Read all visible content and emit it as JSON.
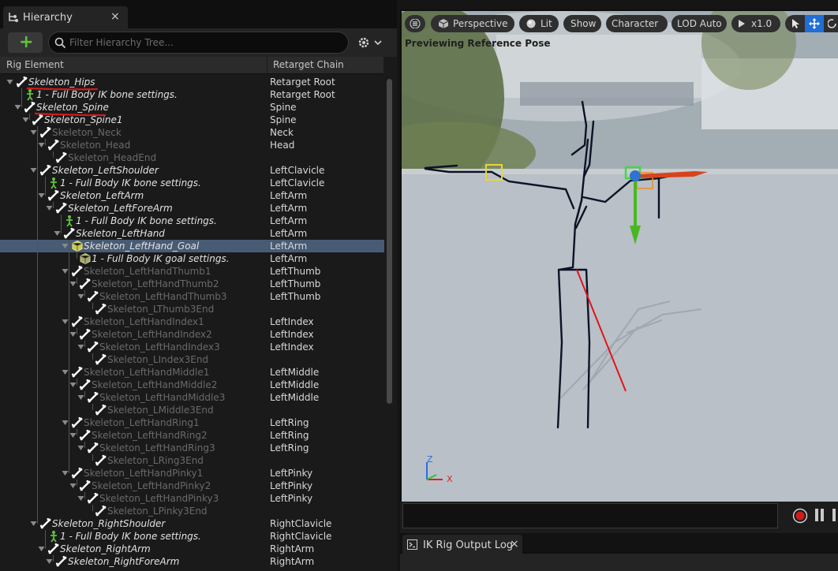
{
  "hierarchy_panel": {
    "tab_label": "Hierarchy",
    "tab_close": "×",
    "search_placeholder": "Filter Hierarchy Tree...",
    "add_label": "+",
    "columns": {
      "rig_element": "Rig Element",
      "retarget_chain": "Retarget Chain"
    },
    "rows": [
      {
        "label": "Skeleton_Hips",
        "chain": "Retarget Root",
        "depth": 0,
        "icon": "bone",
        "expanded": true
      },
      {
        "label": "1 - Full Body IK bone settings.",
        "chain": "Retarget Root",
        "depth": 1,
        "icon": "ik-setting"
      },
      {
        "label": "Skeleton_Spine",
        "chain": "Spine",
        "depth": 1,
        "icon": "bone",
        "expanded": true
      },
      {
        "label": "Skeleton_Spine1",
        "chain": "Spine",
        "depth": 2,
        "icon": "bone",
        "expanded": true
      },
      {
        "label": "Skeleton_Neck",
        "chain": "Neck",
        "depth": 3,
        "icon": "bone",
        "expanded": true,
        "dim": true
      },
      {
        "label": "Skeleton_Head",
        "chain": "Head",
        "depth": 4,
        "icon": "bone",
        "expanded": true,
        "dim": true
      },
      {
        "label": "Skeleton_HeadEnd",
        "chain": "",
        "depth": 5,
        "icon": "bone",
        "dim": true
      },
      {
        "label": "Skeleton_LeftShoulder",
        "chain": "LeftClavicle",
        "depth": 3,
        "icon": "bone",
        "expanded": true
      },
      {
        "label": "1 - Full Body IK bone settings.",
        "chain": "LeftClavicle",
        "depth": 4,
        "icon": "ik-setting"
      },
      {
        "label": "Skeleton_LeftArm",
        "chain": "LeftArm",
        "depth": 4,
        "icon": "bone",
        "expanded": true
      },
      {
        "label": "Skeleton_LeftForeArm",
        "chain": "LeftArm",
        "depth": 5,
        "icon": "bone",
        "expanded": true
      },
      {
        "label": "1 - Full Body IK bone settings.",
        "chain": "LeftArm",
        "depth": 6,
        "icon": "ik-setting"
      },
      {
        "label": "Skeleton_LeftHand",
        "chain": "LeftArm",
        "depth": 6,
        "icon": "bone",
        "expanded": true
      },
      {
        "label": "Skeleton_LeftHand_Goal",
        "chain": "LeftArm",
        "depth": 7,
        "icon": "goal",
        "expanded": true,
        "selected": true
      },
      {
        "label": "1 - Full Body IK goal settings.",
        "chain": "LeftArm",
        "depth": 8,
        "icon": "goal-setting"
      },
      {
        "label": "Skeleton_LeftHandThumb1",
        "chain": "LeftThumb",
        "depth": 7,
        "icon": "bone",
        "expanded": true,
        "dim": true
      },
      {
        "label": "Skeleton_LeftHandThumb2",
        "chain": "LeftThumb",
        "depth": 8,
        "icon": "bone",
        "expanded": true,
        "dim": true
      },
      {
        "label": "Skeleton_LeftHandThumb3",
        "chain": "LeftThumb",
        "depth": 9,
        "icon": "bone",
        "expanded": true,
        "dim": true
      },
      {
        "label": "Skeleton_LThumb3End",
        "chain": "",
        "depth": 10,
        "icon": "bone",
        "dim": true
      },
      {
        "label": "Skeleton_LeftHandIndex1",
        "chain": "LeftIndex",
        "depth": 7,
        "icon": "bone",
        "expanded": true,
        "dim": true
      },
      {
        "label": "Skeleton_LeftHandIndex2",
        "chain": "LeftIndex",
        "depth": 8,
        "icon": "bone",
        "expanded": true,
        "dim": true
      },
      {
        "label": "Skeleton_LeftHandIndex3",
        "chain": "LeftIndex",
        "depth": 9,
        "icon": "bone",
        "expanded": true,
        "dim": true
      },
      {
        "label": "Skeleton_LIndex3End",
        "chain": "",
        "depth": 10,
        "icon": "bone",
        "dim": true
      },
      {
        "label": "Skeleton_LeftHandMiddle1",
        "chain": "LeftMiddle",
        "depth": 7,
        "icon": "bone",
        "expanded": true,
        "dim": true
      },
      {
        "label": "Skeleton_LeftHandMiddle2",
        "chain": "LeftMiddle",
        "depth": 8,
        "icon": "bone",
        "expanded": true,
        "dim": true
      },
      {
        "label": "Skeleton_LeftHandMiddle3",
        "chain": "LeftMiddle",
        "depth": 9,
        "icon": "bone",
        "expanded": true,
        "dim": true
      },
      {
        "label": "Skeleton_LMiddle3End",
        "chain": "",
        "depth": 10,
        "icon": "bone",
        "dim": true
      },
      {
        "label": "Skeleton_LeftHandRing1",
        "chain": "LeftRing",
        "depth": 7,
        "icon": "bone",
        "expanded": true,
        "dim": true
      },
      {
        "label": "Skeleton_LeftHandRing2",
        "chain": "LeftRing",
        "depth": 8,
        "icon": "bone",
        "expanded": true,
        "dim": true
      },
      {
        "label": "Skeleton_LeftHandRing3",
        "chain": "LeftRing",
        "depth": 9,
        "icon": "bone",
        "expanded": true,
        "dim": true
      },
      {
        "label": "Skeleton_LRing3End",
        "chain": "",
        "depth": 10,
        "icon": "bone",
        "dim": true
      },
      {
        "label": "Skeleton_LeftHandPinky1",
        "chain": "LeftPinky",
        "depth": 7,
        "icon": "bone",
        "expanded": true,
        "dim": true
      },
      {
        "label": "Skeleton_LeftHandPinky2",
        "chain": "LeftPinky",
        "depth": 8,
        "icon": "bone",
        "expanded": true,
        "dim": true
      },
      {
        "label": "Skeleton_LeftHandPinky3",
        "chain": "LeftPinky",
        "depth": 9,
        "icon": "bone",
        "expanded": true,
        "dim": true
      },
      {
        "label": "Skeleton_LPinky3End",
        "chain": "",
        "depth": 10,
        "icon": "bone",
        "dim": true
      },
      {
        "label": "Skeleton_RightShoulder",
        "chain": "RightClavicle",
        "depth": 3,
        "icon": "bone",
        "expanded": true
      },
      {
        "label": "1 - Full Body IK bone settings.",
        "chain": "RightClavicle",
        "depth": 4,
        "icon": "ik-setting"
      },
      {
        "label": "Skeleton_RightArm",
        "chain": "RightArm",
        "depth": 4,
        "icon": "bone",
        "expanded": true
      },
      {
        "label": "Skeleton_RightForeArm",
        "chain": "RightArm",
        "depth": 5,
        "icon": "bone",
        "expanded": true
      }
    ]
  },
  "viewport": {
    "menu_icon": "hamburger-icon",
    "perspective": "Perspective",
    "lit": "Lit",
    "show": "Show",
    "character": "Character",
    "lod": "LOD Auto",
    "play_speed": "x1.0",
    "status": "Previewing Reference Pose",
    "axis_z": "Z",
    "axis_x": "X"
  },
  "output_log": {
    "tab_label": "IK Rig Output Log",
    "tab_close": "×"
  },
  "colors": {
    "selection": "#485b74",
    "bone_icon": "#ffffff",
    "goal_icon": "#d6d65a",
    "ik_setting_icon": "#5fc43a",
    "accent_button": "#1f6fd6",
    "record": "#d11b1b"
  }
}
